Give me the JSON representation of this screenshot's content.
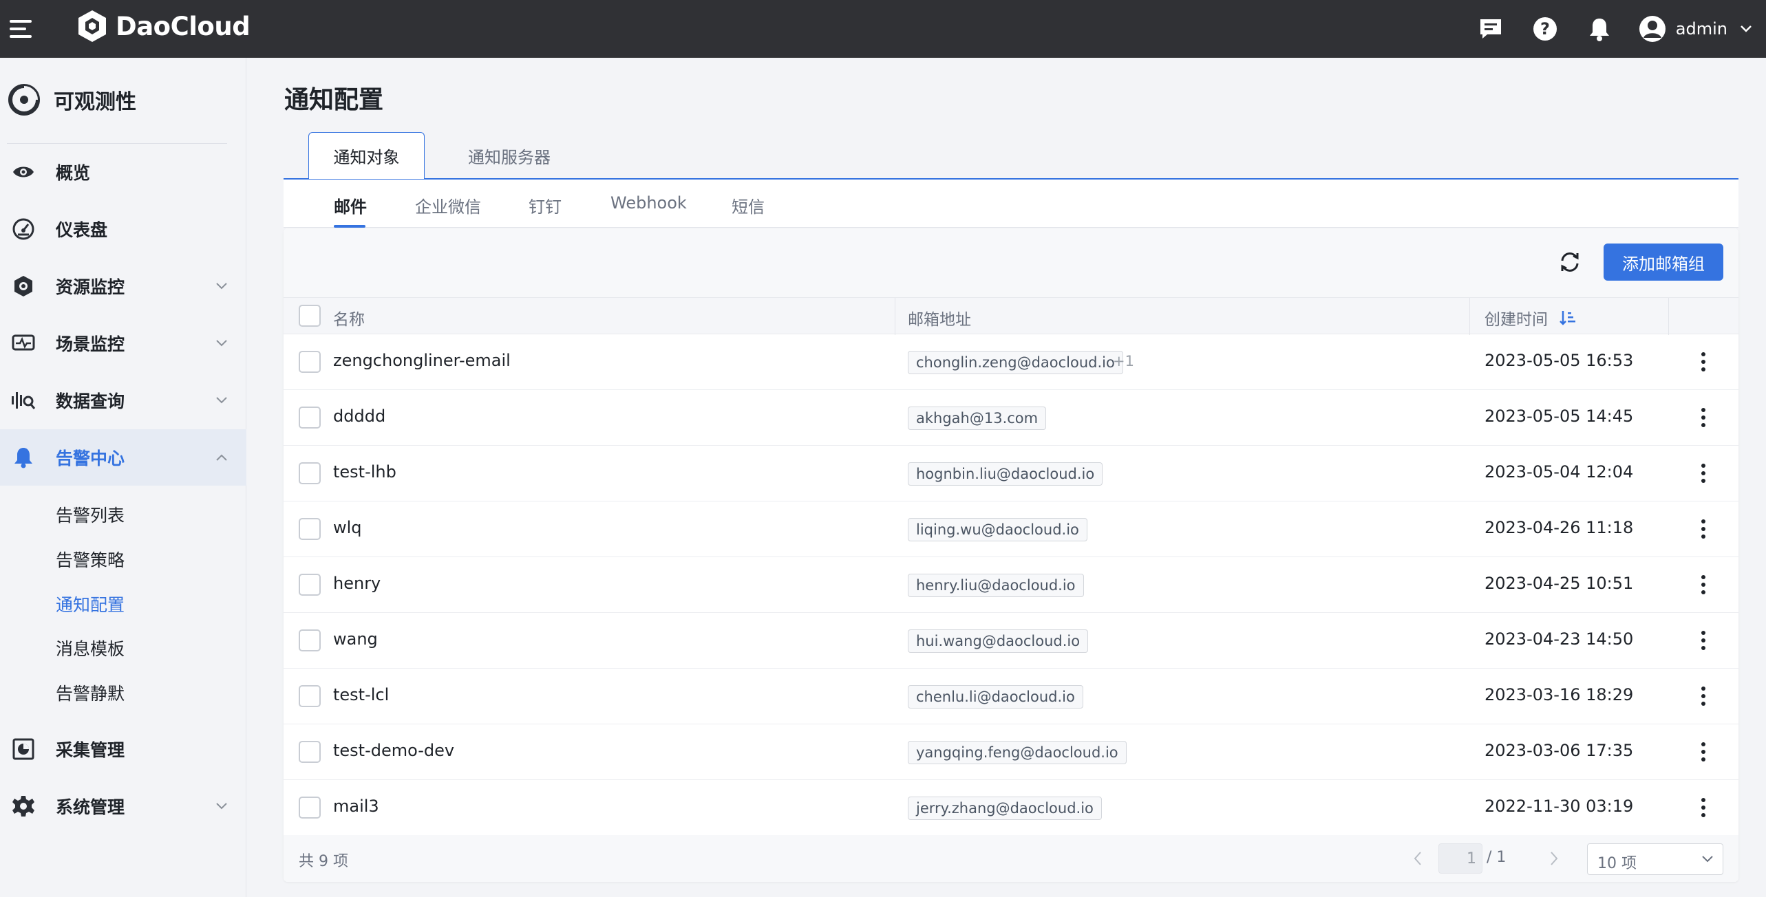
{
  "topbar": {
    "brand": "DaoCloud",
    "user": "admin"
  },
  "sidebar": {
    "module_title": "可观测性",
    "items": [
      {
        "label": "概览"
      },
      {
        "label": "仪表盘"
      },
      {
        "label": "资源监控"
      },
      {
        "label": "场景监控"
      },
      {
        "label": "数据查询"
      },
      {
        "label": "告警中心"
      },
      {
        "label": "采集管理"
      },
      {
        "label": "系统管理"
      }
    ],
    "alert_sub_items": [
      {
        "label": "告警列表"
      },
      {
        "label": "告警策略"
      },
      {
        "label": "通知配置"
      },
      {
        "label": "消息模板"
      },
      {
        "label": "告警静默"
      }
    ]
  },
  "main": {
    "title": "通知配置",
    "tabs": [
      {
        "label": "通知对象"
      },
      {
        "label": "通知服务器"
      }
    ],
    "subtabs": [
      {
        "label": "邮件"
      },
      {
        "label": "企业微信"
      },
      {
        "label": "钉钉"
      },
      {
        "label": "Webhook"
      },
      {
        "label": "短信"
      }
    ],
    "add_button": "添加邮箱组",
    "columns": {
      "name": "名称",
      "email": "邮箱地址",
      "created": "创建时间"
    },
    "rows": [
      {
        "name": "zengchongliner-email",
        "email": "chonglin.zeng@daocloud.io",
        "extra": "+1",
        "created": "2023-05-05 16:53"
      },
      {
        "name": "ddddd",
        "email": "akhgah@13.com",
        "extra": "",
        "created": "2023-05-05 14:45"
      },
      {
        "name": "test-lhb",
        "email": "hognbin.liu@daocloud.io",
        "extra": "",
        "created": "2023-05-04 12:04"
      },
      {
        "name": "wlq",
        "email": "liqing.wu@daocloud.io",
        "extra": "",
        "created": "2023-04-26 11:18"
      },
      {
        "name": "henry",
        "email": "henry.liu@daocloud.io",
        "extra": "",
        "created": "2023-04-25 10:51"
      },
      {
        "name": "wang",
        "email": "hui.wang@daocloud.io",
        "extra": "",
        "created": "2023-04-23 14:50"
      },
      {
        "name": "test-lcl",
        "email": "chenlu.li@daocloud.io",
        "extra": "",
        "created": "2023-03-16 18:29"
      },
      {
        "name": "test-demo-dev",
        "email": "yangqing.feng@daocloud.io",
        "extra": "",
        "created": "2023-03-06 17:35"
      },
      {
        "name": "mail3",
        "email": "jerry.zhang@daocloud.io",
        "extra": "",
        "created": "2022-11-30 03:19"
      }
    ],
    "footer": {
      "total": "共 9 项",
      "page": "1",
      "page_total": "/ 1",
      "page_size": "10 项"
    }
  },
  "colors": {
    "topbar": "#303135",
    "accent": "#3573e0"
  }
}
